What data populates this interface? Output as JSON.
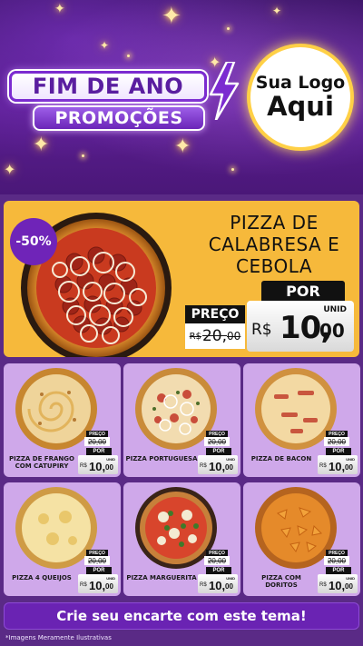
{
  "header": {
    "title_main": "FIM DE ANO",
    "title_sub": "PROMOÇÕES",
    "logo_line1": "Sua Logo",
    "logo_line2": "Aqui"
  },
  "featured": {
    "discount": "-50%",
    "name": "PIZZA DE CALABRESA E CEBOLA",
    "por_label": "POR",
    "preco_label": "PREÇO",
    "old_currency": "R$",
    "old_int": "20,",
    "old_cents": "00",
    "unid": "UNID",
    "new_currency": "R$",
    "new_int": "10,",
    "new_cents": "00"
  },
  "products": [
    {
      "name": "PIZZA DE FRANGO COM CATUPIRY",
      "preco_label": "PREÇO",
      "old": "20,00",
      "por_label": "POR",
      "unid": "UNID",
      "currency": "R$",
      "new_int": "10,",
      "new_cents": "00"
    },
    {
      "name": "PIZZA PORTUGUESA",
      "preco_label": "PREÇO",
      "old": "20,00",
      "por_label": "POR",
      "unid": "UNID",
      "currency": "R$",
      "new_int": "10,",
      "new_cents": "00"
    },
    {
      "name": "PIZZA DE BACON",
      "preco_label": "PREÇO",
      "old": "20,00",
      "por_label": "POR",
      "unid": "UNID",
      "currency": "R$",
      "new_int": "10,",
      "new_cents": "00"
    },
    {
      "name": "PIZZA 4 QUEIJOS",
      "preco_label": "PREÇO",
      "old": "20,00",
      "por_label": "POR",
      "unid": "UNID",
      "currency": "R$",
      "new_int": "10,",
      "new_cents": "00"
    },
    {
      "name": "PIZZA MARGUERITA",
      "preco_label": "PREÇO",
      "old": "20,00",
      "por_label": "POR",
      "unid": "UNID",
      "currency": "R$",
      "new_int": "10,",
      "new_cents": "00"
    },
    {
      "name": "PIZZA COM DORITOS",
      "preco_label": "PREÇO",
      "old": "20,00",
      "por_label": "POR",
      "unid": "UNID",
      "currency": "R$",
      "new_int": "10,",
      "new_cents": "00"
    }
  ],
  "cta": {
    "label": "Crie seu encarte com este tema!"
  },
  "footnote": "*Imagens Meramente Ilustrativas",
  "colors": {
    "background": "#5a2a86",
    "featured_bg": "#f6b93b",
    "card_bg": "#cfa8ea",
    "cta_bg": "#6a23b3",
    "logo_ring": "#ffd046"
  }
}
